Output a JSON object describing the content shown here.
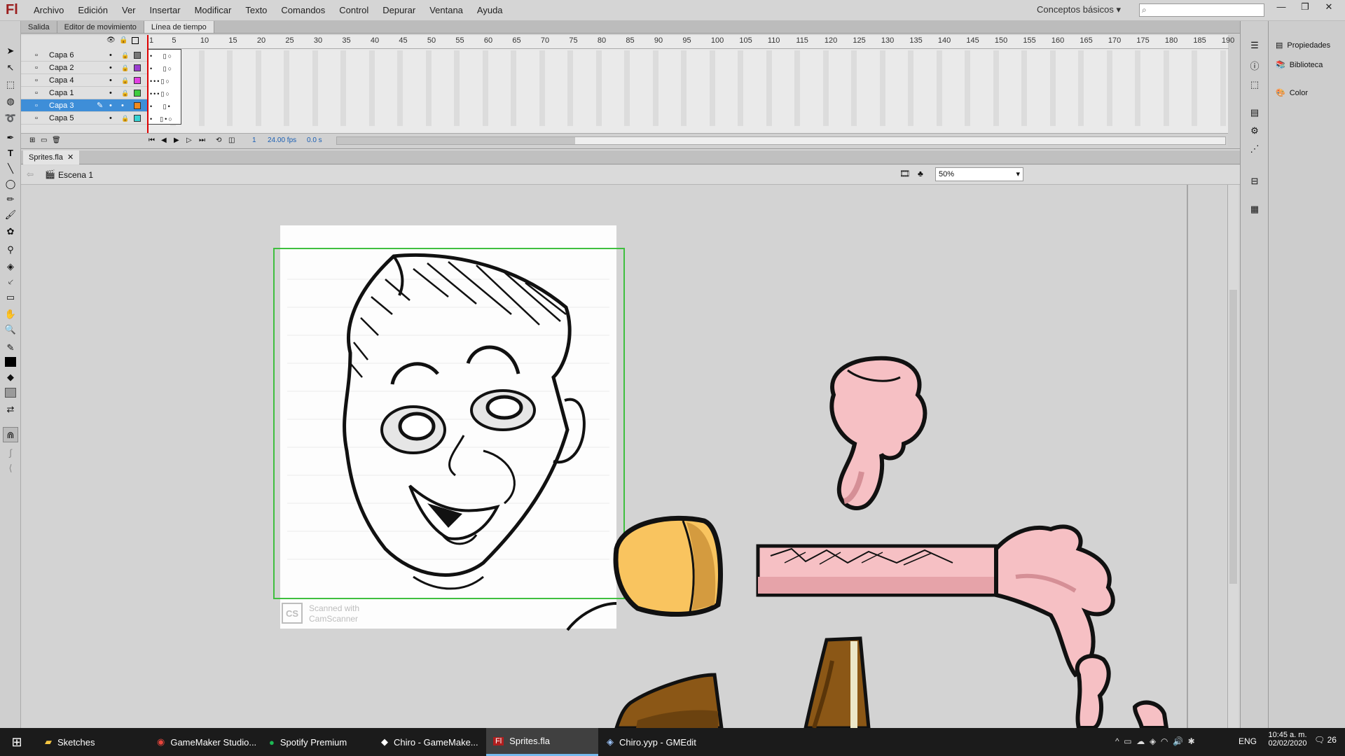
{
  "app": {
    "logo": "Fl"
  },
  "menu": [
    "Archivo",
    "Edición",
    "Ver",
    "Insertar",
    "Modificar",
    "Texto",
    "Comandos",
    "Control",
    "Depurar",
    "Ventana",
    "Ayuda"
  ],
  "workspace": "Conceptos básicos",
  "panel_tabs": [
    "Salida",
    "Editor de movimiento",
    "Línea de tiempo"
  ],
  "layers": [
    "Capa 6",
    "Capa 2",
    "Capa 4",
    "Capa 1",
    "Capa 3",
    "Capa 5"
  ],
  "layer_colors": [
    "#777777",
    "#9b3fd0",
    "#e340e3",
    "#3fcc3f",
    "#f08a1e",
    "#36d3d3"
  ],
  "selected_layer": "Capa 3",
  "ruler": [
    "1",
    "5",
    "10",
    "15",
    "20",
    "25",
    "30",
    "35",
    "40",
    "45",
    "50",
    "55",
    "60",
    "65",
    "70",
    "75",
    "80",
    "85",
    "90",
    "95",
    "100",
    "105",
    "110",
    "115",
    "120",
    "125",
    "130",
    "135",
    "140",
    "145",
    "150",
    "155",
    "160",
    "165",
    "170",
    "175",
    "180",
    "185",
    "190"
  ],
  "timeline_footer": {
    "frame": "1",
    "fps": "24.00 fps",
    "time": "0.0 s"
  },
  "document_tab": "Sprites.fla",
  "scene": "Escena 1",
  "zoom": "50%",
  "right_panel": [
    "Propiedades",
    "Biblioteca",
    "Color"
  ],
  "watermark": {
    "badge": "CS",
    "line1": "Scanned with",
    "line2": "CamScanner"
  },
  "taskbar": {
    "items": [
      "Sketches",
      "GameMaker Studio...",
      "Spotify Premium",
      "Chiro - GameMake...",
      "Sprites.fla",
      "Chiro.yyp - GMEdit"
    ],
    "active": "Sprites.fla",
    "lang": "ENG",
    "time": "10:45 a. m.",
    "date": "02/02/2020",
    "notifications": "26"
  }
}
